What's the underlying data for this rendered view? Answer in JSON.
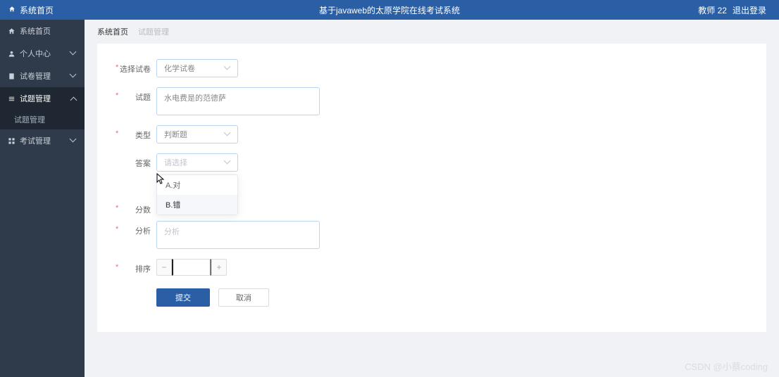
{
  "header": {
    "home": "系统首页",
    "title": "基于javaweb的太原学院在线考试系统",
    "user": "教师 22",
    "logout": "退出登录"
  },
  "sidebar": {
    "home": "系统首页",
    "profile": "个人中心",
    "paper": "试卷管理",
    "question": "试题管理",
    "question_sub": "试题管理",
    "exam": "考试管理"
  },
  "breadcrumb": {
    "a": "系统首页",
    "b": "试题管理"
  },
  "form": {
    "select_paper": {
      "label": "选择试卷",
      "value": "化学试卷"
    },
    "question": {
      "label": "试题",
      "value": "水电费是的范德萨"
    },
    "type": {
      "label": "类型",
      "value": "判断题"
    },
    "answer": {
      "label": "答案",
      "placeholder": "请选择"
    },
    "score": {
      "label": "分数"
    },
    "analysis": {
      "label": "分析",
      "placeholder": "分析"
    },
    "sort": {
      "label": "排序",
      "minus": "−",
      "plus": "+"
    },
    "submit": "提交",
    "cancel": "取消"
  },
  "dropdown": {
    "a": "A.对",
    "b": "B.错"
  },
  "watermark": "CSDN @小蔡coding"
}
